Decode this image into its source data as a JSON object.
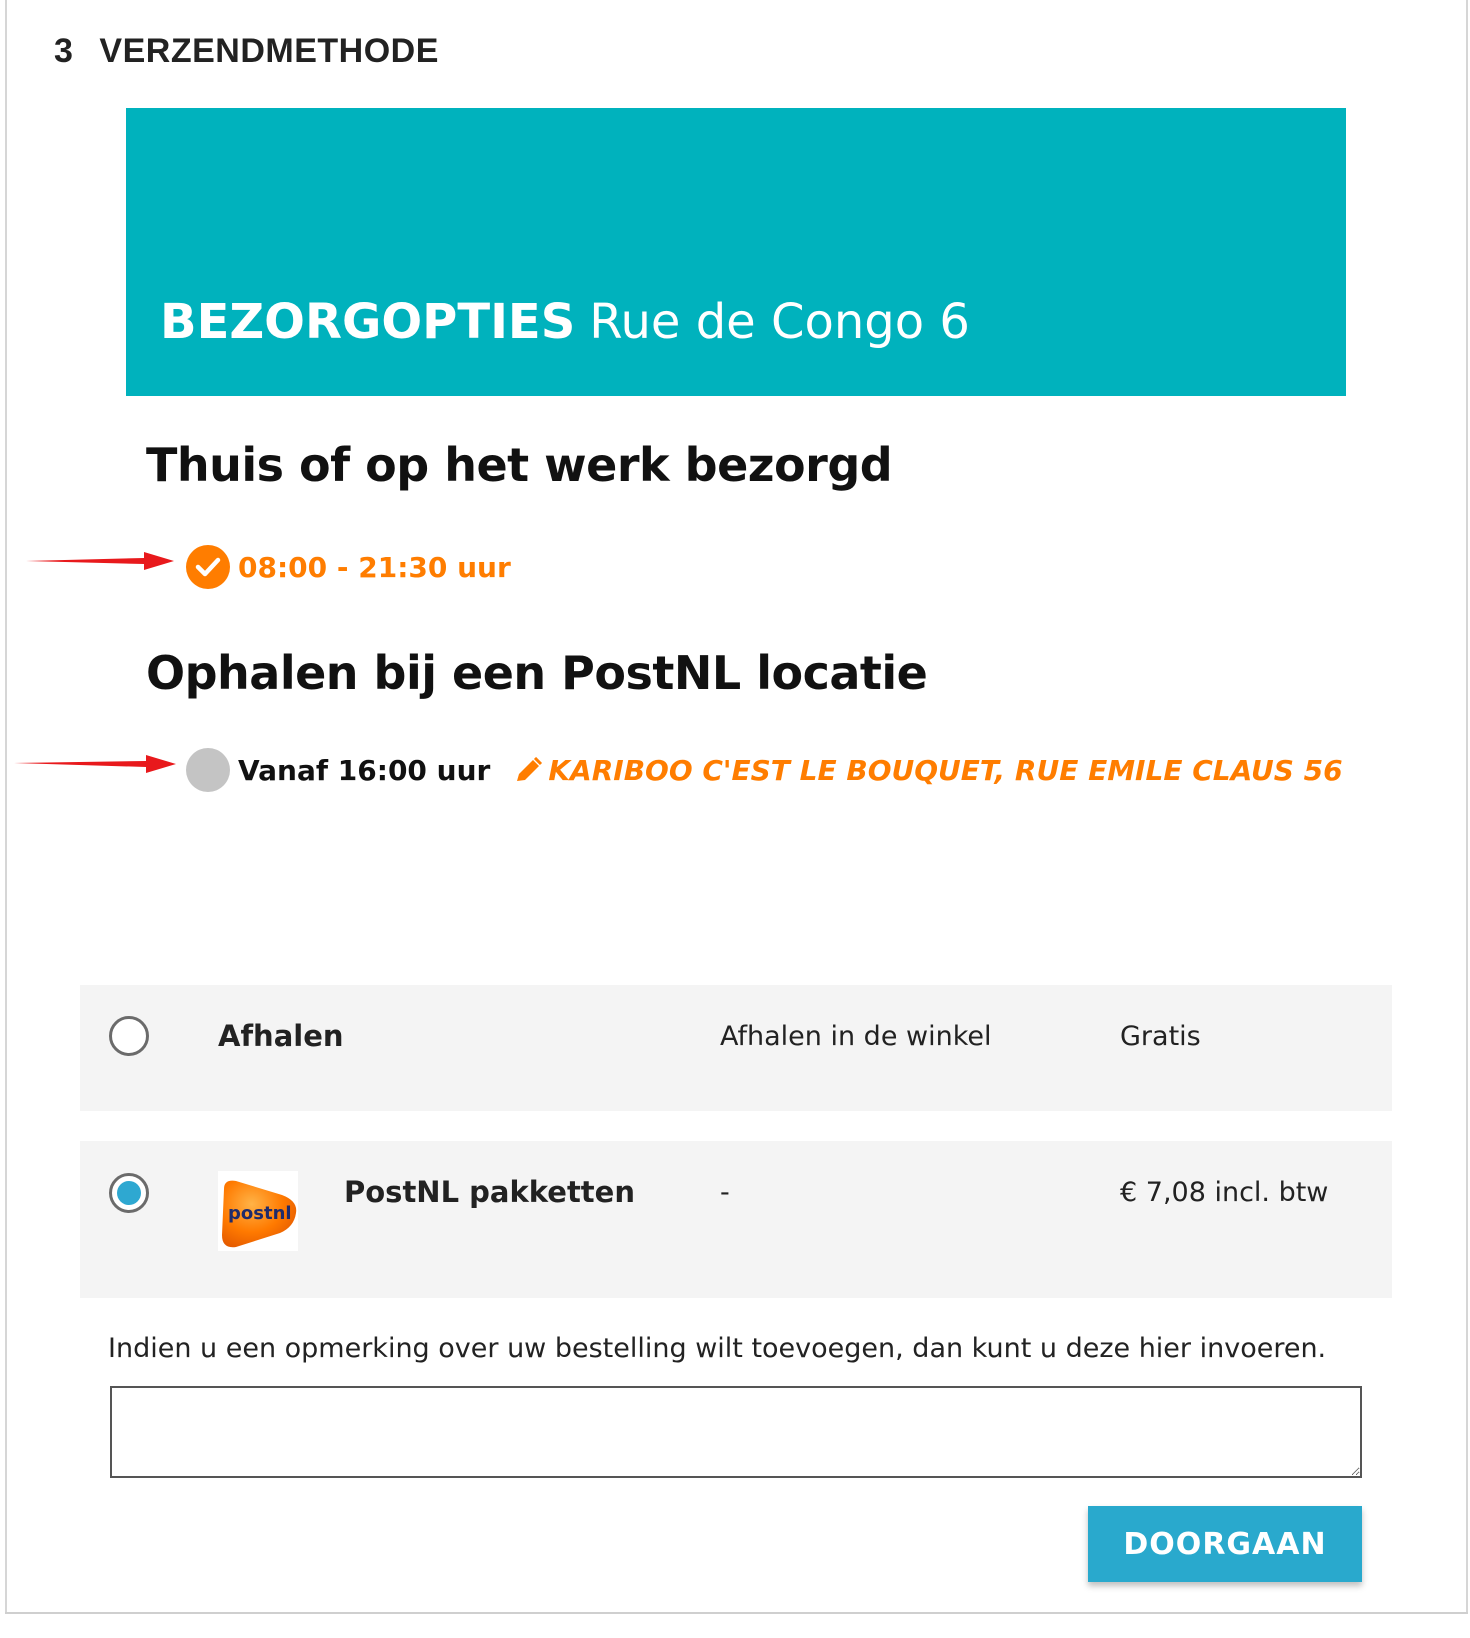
{
  "section": {
    "number": "3",
    "title": "VERZENDMETHODE"
  },
  "banner": {
    "title_bold": "BEZORGOPTIES",
    "address": "Rue de Congo 6",
    "color": "#00b2bd"
  },
  "delivery": {
    "home_heading": "Thuis of op het werk bezorgd",
    "home_option": {
      "time": "08:00 - 21:30 uur",
      "selected": true,
      "icon": "check-circle-icon"
    },
    "pickup_heading": "Ophalen bij een PostNL locatie",
    "pickup_option": {
      "time": "Vanaf 16:00 uur",
      "selected": false,
      "location": "KARIBOO C'EST LE BOUQUET, RUE EMILE CLAUS 56",
      "location_icon": "pencil-icon"
    },
    "accent_color": "#ff7d00"
  },
  "shipping_methods": [
    {
      "name": "Afhalen",
      "description": "Afhalen in de winkel",
      "price": "Gratis",
      "selected": false
    },
    {
      "name": "PostNL pakketten",
      "description": "-",
      "price": "€ 7,08 incl. btw",
      "selected": true,
      "logo_text": "postnl"
    }
  ],
  "remark": {
    "label": "Indien u een opmerking over uw bestelling wilt toevoegen, dan kunt u deze hier invoeren.",
    "value": ""
  },
  "actions": {
    "continue_label": "DOORGAAN",
    "button_color": "#29a9cd"
  }
}
